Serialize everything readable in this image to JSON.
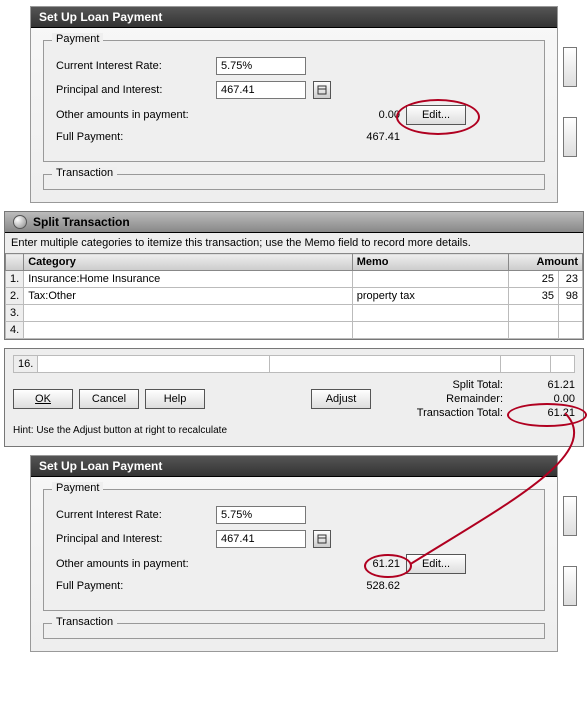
{
  "loan1": {
    "title": "Set Up Loan Payment",
    "group_payment": "Payment",
    "group_transaction": "Transaction",
    "labels": {
      "rate": "Current Interest Rate:",
      "pi": "Principal and Interest:",
      "other": "Other amounts in payment:",
      "full": "Full Payment:"
    },
    "values": {
      "rate": "5.75%",
      "pi": "467.41",
      "other": "0.00",
      "full": "467.41"
    },
    "edit_btn": "Edit..."
  },
  "split": {
    "title": "Split Transaction",
    "desc": "Enter multiple categories to itemize this transaction; use the Memo field to record more details.",
    "headers": {
      "category": "Category",
      "memo": "Memo",
      "amount": "Amount"
    },
    "rows": [
      {
        "num": "1.",
        "category": "Insurance:Home Insurance",
        "memo": "",
        "amount": "25",
        "cents": "23"
      },
      {
        "num": "2.",
        "category": "Tax:Other",
        "memo": "property tax",
        "amount": "35",
        "cents": "98"
      },
      {
        "num": "3.",
        "category": "",
        "memo": "",
        "amount": "",
        "cents": ""
      },
      {
        "num": "4.",
        "category": "",
        "memo": "",
        "amount": "",
        "cents": ""
      }
    ],
    "last_row": "16."
  },
  "totals": {
    "ok": "OK",
    "cancel": "Cancel",
    "help": "Help",
    "adjust": "Adjust",
    "hint": "Hint: Use the Adjust button at right to recalculate",
    "labels": {
      "split_total": "Split Total:",
      "remainder": "Remainder:",
      "txn_total": "Transaction Total:"
    },
    "values": {
      "split_total": "61.21",
      "remainder": "0.00",
      "txn_total": "61.21"
    }
  },
  "loan2": {
    "title": "Set Up Loan Payment",
    "group_payment": "Payment",
    "group_transaction": "Transaction",
    "labels": {
      "rate": "Current Interest Rate:",
      "pi": "Principal and Interest:",
      "other": "Other amounts in payment:",
      "full": "Full Payment:"
    },
    "values": {
      "rate": "5.75%",
      "pi": "467.41",
      "other": "61.21",
      "full": "528.62"
    },
    "edit_btn": "Edit..."
  }
}
